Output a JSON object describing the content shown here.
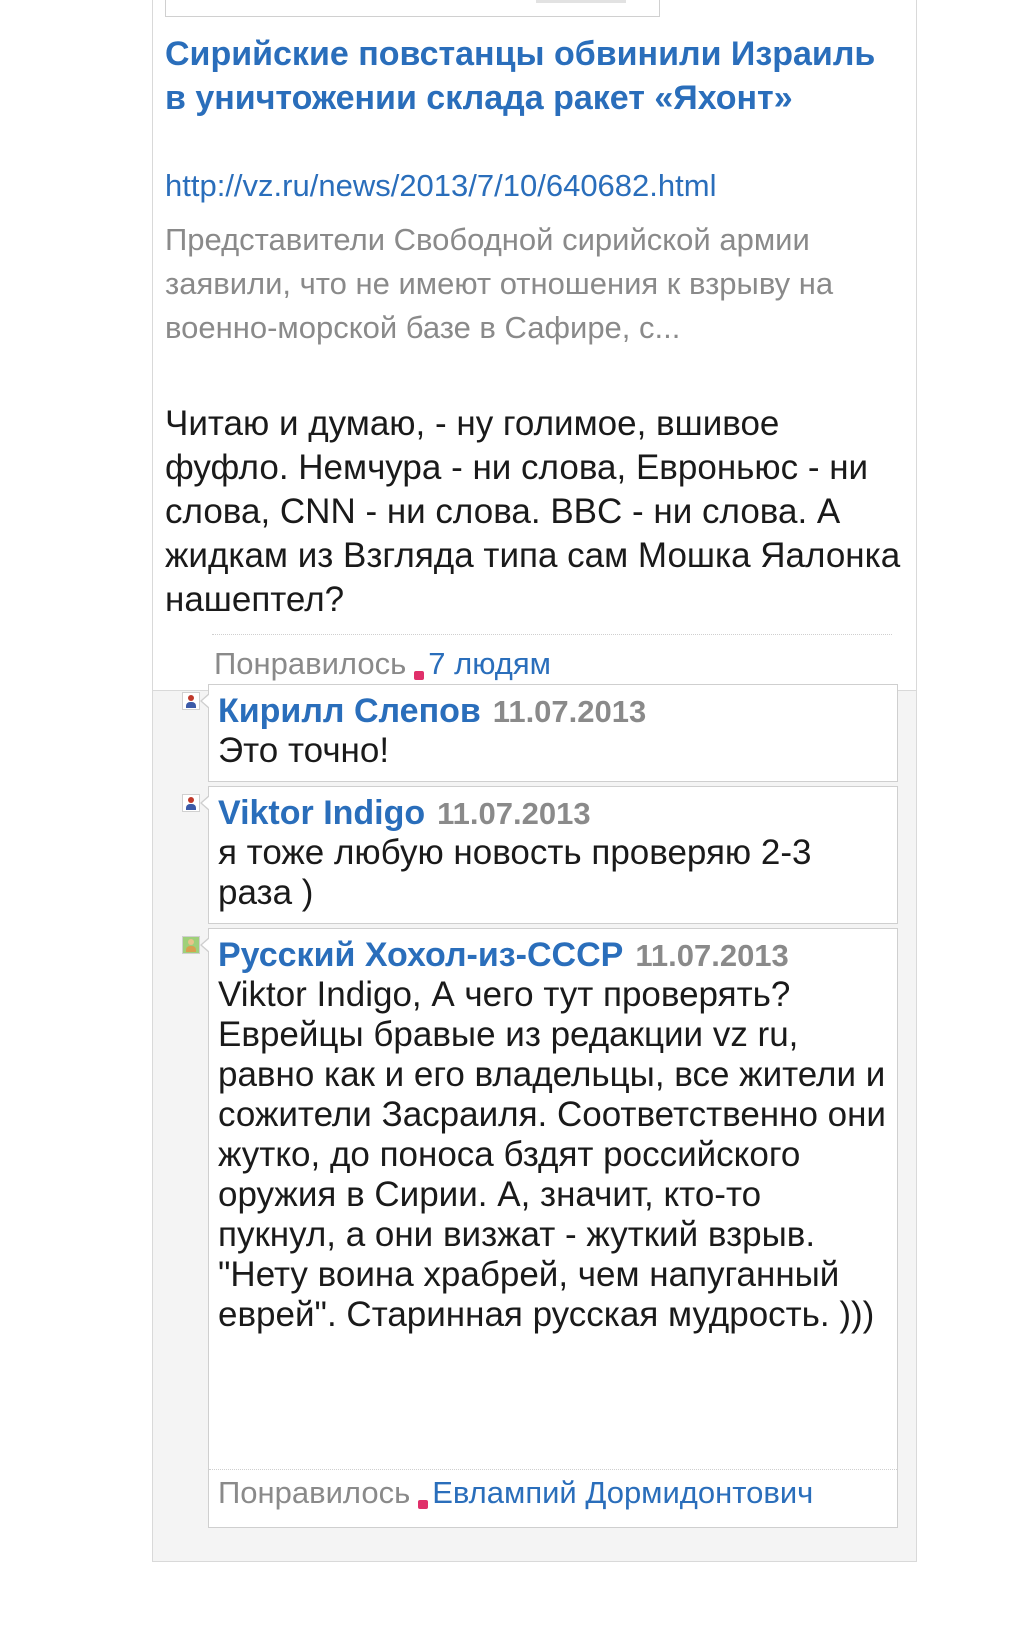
{
  "post": {
    "link_title": "Сирийские повстанцы обвинили Израиль в уничтожении склада ракет «Яхонт»",
    "link_url": "http://vz.ru/news/2013/7/10/640682.html",
    "link_description": "Представители Свободной сирийской армии заявили, что не имеют отношения к взрыву на военно-морской базе в Сафире, с...",
    "text": "Читаю и думаю, - ну голимое, вшивое фуфло. Немчура - ни слова, Евроньюс - ни слова, CNN - ни слова. BBC - ни слова. А жидкам из Взгляда типа сам Мошка Яалонка нашептел?",
    "likes_label": "Понравилось",
    "likes_link": "7 людям"
  },
  "comments": [
    {
      "author": "Кирилл Слепов",
      "date": "11.07.2013",
      "text": "Это точно!",
      "avatar": "user-silhouette-icon"
    },
    {
      "author": "Viktor Indigo",
      "date": "11.07.2013",
      "text": "я тоже любую новость проверяю 2-3 раза )",
      "avatar": "user-silhouette-icon"
    },
    {
      "author": "Русский Хохол-из-СССР",
      "date": "11.07.2013",
      "text": "Viktor Indigo, А чего тут проверять? Еврейцы бравые из редакции vz ru, равно как и его владельцы, все жители и сожители Засраиля. Соответственно они жутко, до поноса бздят российского оружия в Сирии. А, значит, кто-то пукнул, а они визжат - жуткий взрыв. \"Нету воина храбрей, чем напуганный еврей\". Старинная русская мудрость. )))",
      "avatar": "user-photo-icon",
      "likes_label": "Понравилось",
      "likes_link": "Евлампий Дормидонтович"
    }
  ],
  "colors": {
    "link": "#2a6ebb",
    "muted": "#8a8a8a",
    "heart": "#e0306a"
  }
}
